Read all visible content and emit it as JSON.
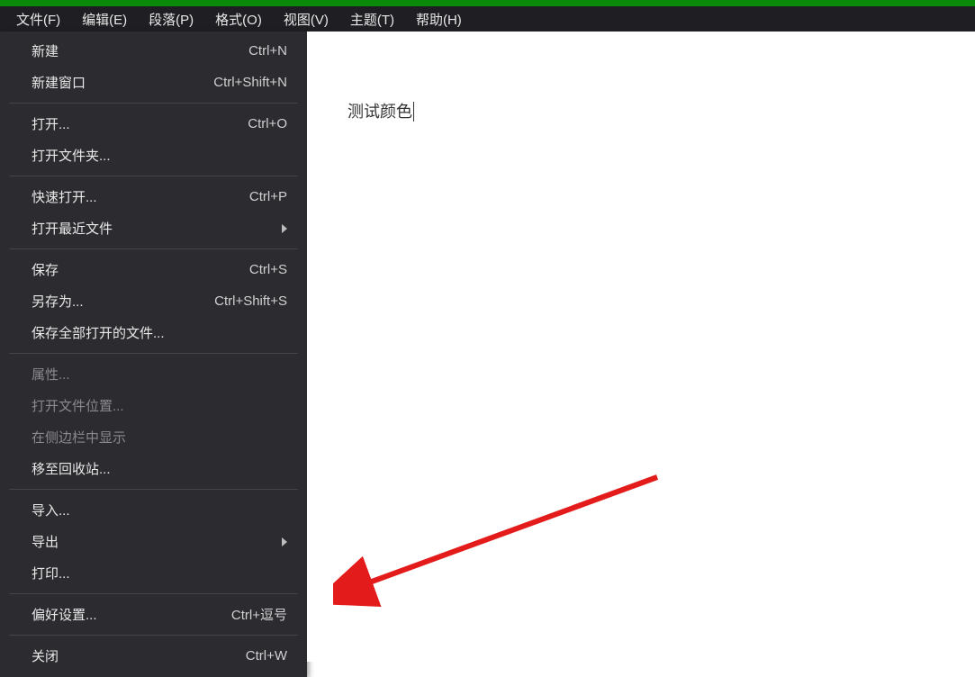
{
  "menubar": {
    "items": [
      {
        "label": "文件(F)"
      },
      {
        "label": "编辑(E)"
      },
      {
        "label": "段落(P)"
      },
      {
        "label": "格式(O)"
      },
      {
        "label": "视图(V)"
      },
      {
        "label": "主题(T)"
      },
      {
        "label": "帮助(H)"
      }
    ]
  },
  "file_menu": {
    "groups": [
      [
        {
          "label": "新建",
          "shortcut": "Ctrl+N",
          "enabled": true,
          "submenu": false
        },
        {
          "label": "新建窗口",
          "shortcut": "Ctrl+Shift+N",
          "enabled": true,
          "submenu": false
        }
      ],
      [
        {
          "label": "打开...",
          "shortcut": "Ctrl+O",
          "enabled": true,
          "submenu": false
        },
        {
          "label": "打开文件夹...",
          "shortcut": "",
          "enabled": true,
          "submenu": false
        }
      ],
      [
        {
          "label": "快速打开...",
          "shortcut": "Ctrl+P",
          "enabled": true,
          "submenu": false
        },
        {
          "label": "打开最近文件",
          "shortcut": "",
          "enabled": true,
          "submenu": true
        }
      ],
      [
        {
          "label": "保存",
          "shortcut": "Ctrl+S",
          "enabled": true,
          "submenu": false
        },
        {
          "label": "另存为...",
          "shortcut": "Ctrl+Shift+S",
          "enabled": true,
          "submenu": false
        },
        {
          "label": "保存全部打开的文件...",
          "shortcut": "",
          "enabled": true,
          "submenu": false
        }
      ],
      [
        {
          "label": "属性...",
          "shortcut": "",
          "enabled": false,
          "submenu": false
        },
        {
          "label": "打开文件位置...",
          "shortcut": "",
          "enabled": false,
          "submenu": false
        },
        {
          "label": "在侧边栏中显示",
          "shortcut": "",
          "enabled": false,
          "submenu": false
        },
        {
          "label": "移至回收站...",
          "shortcut": "",
          "enabled": true,
          "submenu": false
        }
      ],
      [
        {
          "label": "导入...",
          "shortcut": "",
          "enabled": true,
          "submenu": false
        },
        {
          "label": "导出",
          "shortcut": "",
          "enabled": true,
          "submenu": true
        },
        {
          "label": "打印...",
          "shortcut": "",
          "enabled": true,
          "submenu": false
        }
      ],
      [
        {
          "label": "偏好设置...",
          "shortcut": "Ctrl+逗号",
          "enabled": true,
          "submenu": false
        }
      ],
      [
        {
          "label": "关闭",
          "shortcut": "Ctrl+W",
          "enabled": true,
          "submenu": false
        }
      ]
    ]
  },
  "editor": {
    "content": "测试颜色"
  }
}
